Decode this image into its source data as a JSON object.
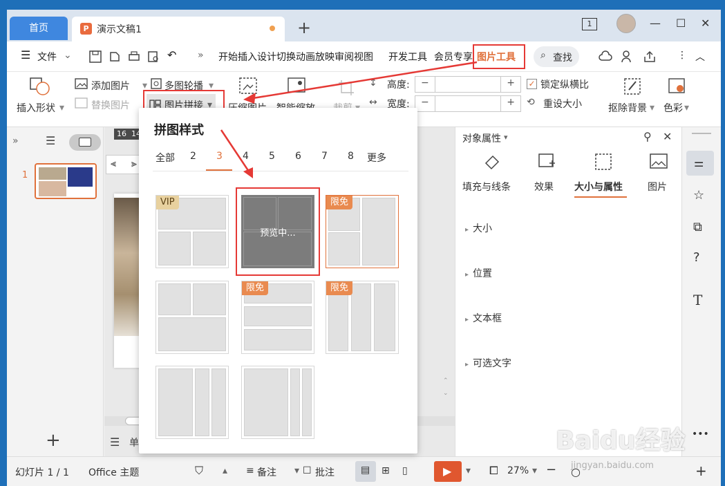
{
  "tabs": {
    "home": "首页",
    "doc_icon": "P",
    "doc_name": "演示文稿1",
    "add": "+"
  },
  "window": {
    "slide_count_icon": "1",
    "minimize": "—",
    "maximize": "☐",
    "close": "✕"
  },
  "menu": {
    "file": "文件",
    "tabs_text": "开始插入设计切换动画放映审阅视图",
    "developer": "开发工具",
    "member": "会员专享",
    "picture_tools": "图片工具",
    "search": "查找",
    "more": "»"
  },
  "ribbon": {
    "insert_shape": "插入形状",
    "add_picture": "添加图片",
    "replace_picture": "替换图片",
    "multi_carousel": "多图轮播",
    "picture_collage": "图片拼接",
    "compress": "压缩图片",
    "smart_scale": "智能缩放",
    "crop": "裁剪",
    "height_label": "高度:",
    "width_label": "宽度:",
    "minus": "−",
    "plus": "+",
    "lock_ratio": "锁定纵横比",
    "reset_size": "重设大小",
    "remove_bg": "抠除背景",
    "color": "色彩"
  },
  "left_panel": {
    "slide_number": "1",
    "add_slide": "+"
  },
  "canvas": {
    "ruler_text": "16  14",
    "notes_label": "单击"
  },
  "collage": {
    "title": "拼图样式",
    "tabs": [
      "全部",
      "2",
      "3",
      "4",
      "5",
      "6",
      "7",
      "8",
      "更多"
    ],
    "active_tab": "3",
    "vip_badge": "VIP",
    "free_badge": "限免",
    "preview_text": "预览中..."
  },
  "right_panel": {
    "title": "对象属性",
    "tabs": [
      "填充与线条",
      "效果",
      "大小与属性",
      "图片"
    ],
    "active_tab": "大小与属性",
    "sections": [
      "大小",
      "位置",
      "文本框",
      "可选文字"
    ]
  },
  "status": {
    "slide_info": "幻灯片 1 / 1",
    "theme": "Office 主题",
    "notes": "备注",
    "comments": "批注",
    "zoom": "27%",
    "more": "•••"
  },
  "watermark": {
    "brand": "Baidu经验",
    "url": "jingyan.baidu.com"
  },
  "colors": {
    "accent": "#e0713b",
    "highlight": "#e53935",
    "home_tab": "#3f87df",
    "play": "#e0572f"
  }
}
